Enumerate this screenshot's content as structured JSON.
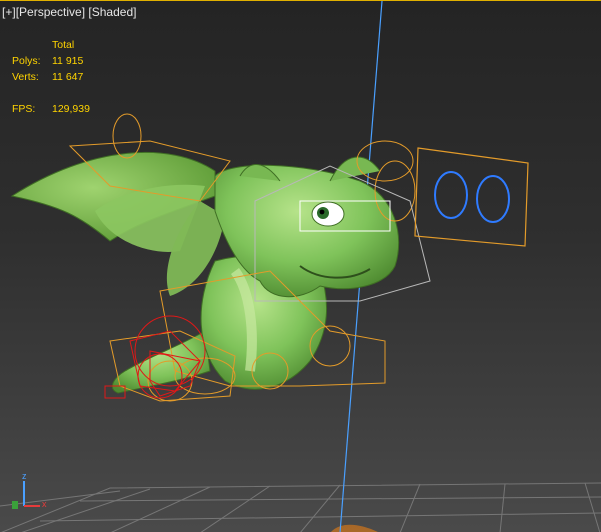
{
  "viewport": {
    "label_plus": "[+]",
    "label_view": "[Perspective]",
    "label_mode": "[Shaded]"
  },
  "stats": {
    "header": "Total",
    "polys_label": "Polys:",
    "polys_value": "11 915",
    "verts_label": "Verts:",
    "verts_value": "11 647",
    "fps_label": "FPS:",
    "fps_value": "129,939"
  },
  "axis_gizmo": {
    "x_label": "x",
    "z_label": "z"
  },
  "colors": {
    "label_text": "#e6e6e6",
    "stats_text": "#ffd400",
    "active_border": "#e0b000",
    "dragon_body": "#7fc35a",
    "rig_orange": "#e39b2a",
    "rig_red": "#e01818",
    "axis_blue": "#4aa0ff",
    "eye_control": "#2f7bff"
  }
}
